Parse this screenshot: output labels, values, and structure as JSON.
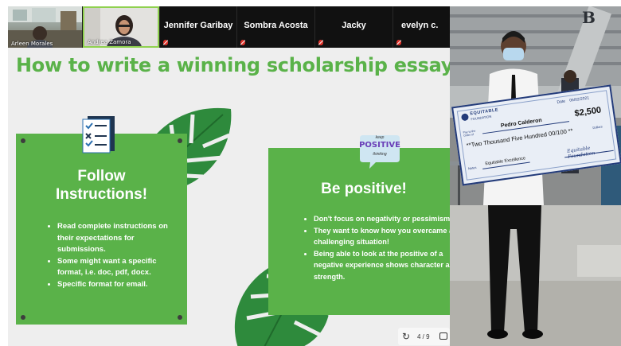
{
  "participants": {
    "video_tiles": [
      {
        "name": "Arleen Morales"
      },
      {
        "name": "Andrea Zamora"
      }
    ],
    "name_tiles": [
      {
        "name": "Jennifer Garibay"
      },
      {
        "name": "Sombra Acosta"
      },
      {
        "name": "Jacky"
      },
      {
        "name": "evelyn c."
      }
    ]
  },
  "slide": {
    "title": "How to write a winning scholarship essay",
    "card_left": {
      "heading_line1": "Follow",
      "heading_line2": "Instructions!",
      "bullets": [
        "Read complete instructions on their expectations for submissions.",
        "Some might want a specific format, i.e. doc, pdf, docx.",
        "Specific format for email."
      ]
    },
    "card_right": {
      "heading": "Be positive!",
      "bubble_line1": "keep",
      "bubble_line2": "POSITIVE",
      "bubble_line3": "thinking",
      "bullets": [
        "Don't focus on negativity or pessimism",
        "They want to know how you overcame a challenging situation!",
        "Being able to look at the positive of a negative experience shows character and strength."
      ]
    },
    "controls": {
      "page": "4 / 9"
    }
  },
  "photo": {
    "check": {
      "org_line1": "EQUITABLE",
      "org_line2": "FOUNDATION",
      "date_label": "Date",
      "date": "06/02/2021",
      "pay_label": "Pay to the Order of",
      "payee": "Pedro Calderon",
      "amount": "$2,500",
      "amount_words": "**Two Thousand Five Hundred 00/100 **",
      "dollars": "Dollars",
      "notes_label": "Notes",
      "notes": "Equitable Excellence",
      "signature": "Equitable Foundation"
    },
    "building_letter": "B"
  }
}
